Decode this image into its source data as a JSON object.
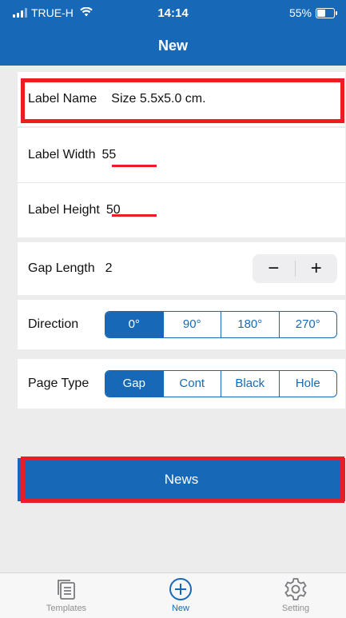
{
  "status": {
    "carrier": "TRUE-H",
    "time": "14:14",
    "battery": "55%",
    "battery_level": 0.55
  },
  "nav": {
    "title": "New"
  },
  "form": {
    "label_name": {
      "label": "Label Name",
      "value": "Size 5.5x5.0 cm."
    },
    "label_width": {
      "label": "Label Width",
      "value": "55"
    },
    "label_height": {
      "label": "Label Height",
      "value": "50"
    },
    "gap_length": {
      "label": "Gap Length",
      "value": "2",
      "minus": "−",
      "plus": "+"
    },
    "direction": {
      "label": "Direction",
      "options": [
        "0°",
        "90°",
        "180°",
        "270°"
      ],
      "selected": "0°"
    },
    "page_type": {
      "label": "Page Type",
      "options": [
        "Gap",
        "Cont",
        "Black",
        "Hole"
      ],
      "selected": "Gap"
    }
  },
  "action": {
    "label": "News"
  },
  "tabs": [
    {
      "label": "Templates",
      "icon": "templates-icon"
    },
    {
      "label": "New",
      "icon": "plus-circle-icon"
    },
    {
      "label": "Setting",
      "icon": "gear-icon"
    }
  ],
  "colors": {
    "primary": "#1769b8",
    "highlight": "#ec1c24",
    "background": "#ececec"
  }
}
